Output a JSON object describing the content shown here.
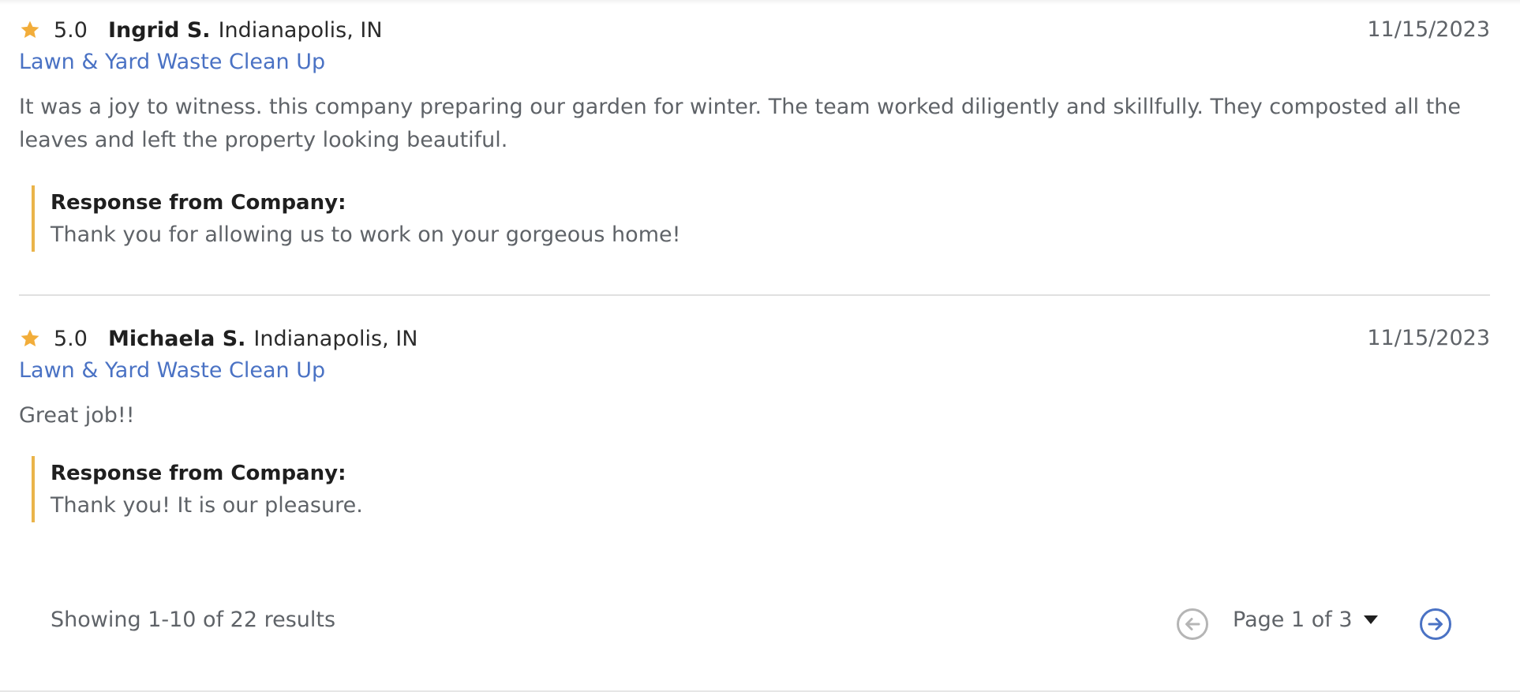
{
  "colors": {
    "star": "#F2AD3A",
    "link": "#4A72C4",
    "accent_border": "#EAB44A",
    "next_button": "#4A72C4",
    "prev_button": "#B5B5B5"
  },
  "reviews": [
    {
      "rating": "5.0",
      "reviewer": "Ingrid S.",
      "location": "Indianapolis, IN",
      "date": "11/15/2023",
      "service": "Lawn & Yard Waste Clean Up",
      "text": "It was a joy to witness. this company preparing our garden for winter. The team worked diligently and skillfully. They composted all the leaves and left the property looking beautiful.",
      "response_title": "Response from Company:",
      "response_text": "Thank you for allowing us to work on your gorgeous home!"
    },
    {
      "rating": "5.0",
      "reviewer": "Michaela S.",
      "location": "Indianapolis, IN",
      "date": "11/15/2023",
      "service": "Lawn & Yard Waste Clean Up",
      "text": "Great job!!",
      "response_title": "Response from Company:",
      "response_text": "Thank you! It is our pleasure."
    }
  ],
  "pagination": {
    "showing": "Showing 1-10 of 22 results",
    "page_label": "Page 1 of 3",
    "prev_icon": "arrow-left-circle-icon",
    "next_icon": "arrow-right-circle-icon",
    "dropdown_icon": "caret-down-icon"
  }
}
